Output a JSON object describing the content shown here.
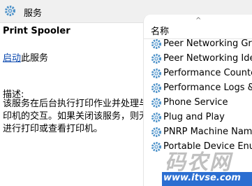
{
  "window": {
    "title": "服务"
  },
  "detail": {
    "service_name": "Print Spooler",
    "action_link": "启动",
    "action_suffix": "此服务",
    "description_label": "描述:",
    "description_text": "该服务在后台执行打印作业并处理与打印机的交互。如果关闭该服务，则无法进行打印或查看打印机。"
  },
  "list": {
    "column_header": "名称",
    "rows": [
      {
        "label": "Peer Networking Grou"
      },
      {
        "label": "Peer Networking Iden"
      },
      {
        "label": "Performance Counter"
      },
      {
        "label": "Performance Logs & A"
      },
      {
        "label": "Phone Service"
      },
      {
        "label": "Plug and Play"
      },
      {
        "label": "PNRP Machine Name"
      },
      {
        "label": "Portable Device Enum"
      }
    ]
  },
  "watermark": {
    "brand": "码农网",
    "url": "www.itvse.com"
  },
  "colors": {
    "link": "#0645ad",
    "watermark_bar": "#2b6ed1",
    "gear": "#4a90c8"
  }
}
